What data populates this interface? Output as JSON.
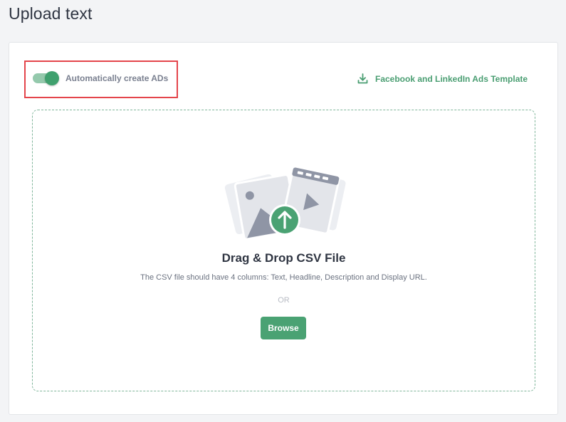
{
  "page": {
    "title": "Upload text"
  },
  "toggle": {
    "label": "Automatically create ADs",
    "checked": true
  },
  "template_link": {
    "label": "Facebook and LinkedIn Ads Template",
    "icon": "download-icon"
  },
  "dropzone": {
    "title": "Drag & Drop CSV File",
    "description": "The CSV file should have 4 columns: Text, Headline, Description and Display URL.",
    "or_label": "OR",
    "browse_label": "Browse",
    "illustration_icon": "upload-images-icon"
  },
  "colors": {
    "accent": "#4aa273",
    "highlight_border": "#e4454b",
    "toggle_track": "#94c9ac",
    "toggle_knob": "#3fa06e"
  }
}
